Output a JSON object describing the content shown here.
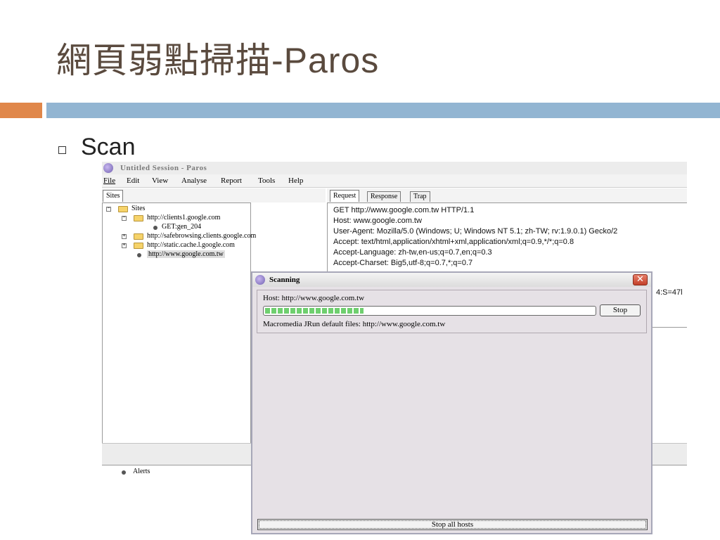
{
  "slide": {
    "title": "網頁弱點掃描-Paros",
    "bullet": "Scan"
  },
  "app": {
    "window_title": "Untitled Session - Paros",
    "menu": [
      "File",
      "Edit",
      "View",
      "Analyse",
      "Report",
      "Tools",
      "Help"
    ],
    "left_tab": "Sites",
    "tree": {
      "root": "Sites",
      "host1": "http://clients1.google.com",
      "host1_child": "GET:gen_204",
      "host2": "http://safebrowsing.clients.google.com",
      "host3": "http://static.cache.l.google.com",
      "host4": "http://www.google.com.tw"
    },
    "right_tabs": [
      "Request",
      "Response",
      "Trap"
    ],
    "request_lines": [
      "GET http://www.google.com.tw HTTP/1.1",
      "Host: www.google.com.tw",
      "User-Agent: Mozilla/5.0 (Windows; U; Windows NT 5.1; zh-TW; rv:1.9.0.1) Gecko/2",
      "Accept: text/html,application/xhtml+xml,application/xml;q=0.9,*/*;q=0.8",
      "Accept-Language: zh-tw,en-us;q=0.7,en;q=0.3",
      "Accept-Charset: Big5,utf-8;q=0.7,*;q=0.7"
    ],
    "request_partial_right": "4:S=47l",
    "alerts_label": "Alerts"
  },
  "dialog": {
    "title": "Scanning",
    "close_glyph": "✕",
    "host_label": "Host:  http://www.google.com.tw",
    "progress": 0.3,
    "stop_label": "Stop",
    "status_text": "Macromedia JRun default files: http://www.google.com.tw",
    "stop_all_label": "Stop all hosts"
  },
  "icons": {
    "app": "paros-logo-icon",
    "folder": "folder-icon",
    "node": "bullet-node-icon"
  },
  "colors": {
    "accent_orange": "#e0874a",
    "accent_blue": "#92b5d2",
    "progress_green": "#6fcf6f",
    "close_red": "#c3402a"
  }
}
